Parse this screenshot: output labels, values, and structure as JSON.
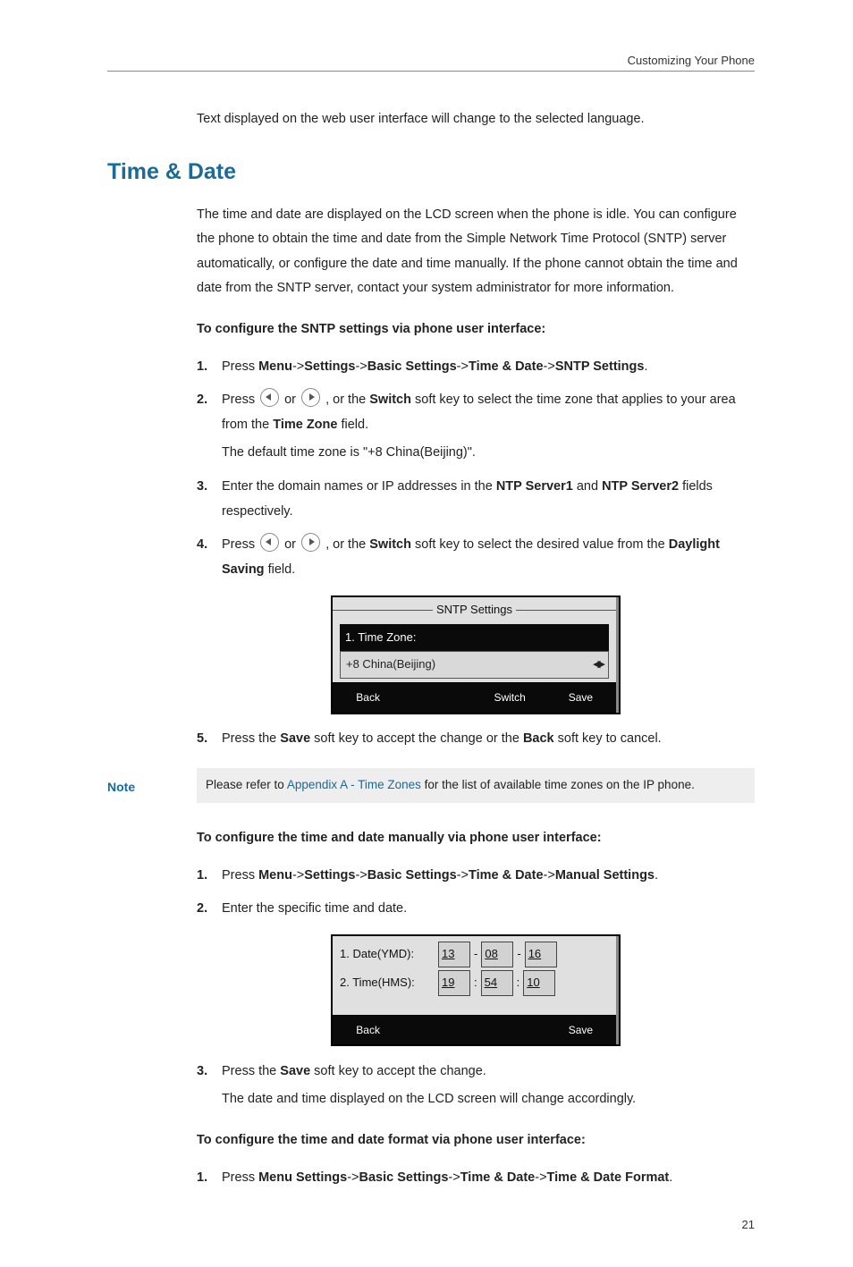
{
  "header": {
    "section": "Customizing Your Phone"
  },
  "intro_continued": "Text displayed on the web user interface will change to the selected language.",
  "section_title": "Time & Date",
  "overview": "The time and date are displayed on the LCD screen when the phone is idle. You can configure the phone to obtain the time and date from the Simple Network Time Protocol (SNTP) server automatically, or configure the date and time manually. If the phone cannot obtain the time and date from the SNTP server, contact your system administrator for more information.",
  "sntp": {
    "heading": "To configure the SNTP settings via phone user interface:",
    "steps": [
      {
        "num": "1.",
        "pre": "Press ",
        "path": [
          "Menu",
          "Settings",
          "Basic Settings",
          "Time & Date",
          "SNTP Settings"
        ],
        "post": "."
      },
      {
        "num": "2.",
        "pre": "Press ",
        "arrows": true,
        "mid1": " , or the ",
        "switch": "Switch",
        "mid2": " soft key to select the time zone that applies to your area from the ",
        "field": "Time Zone",
        "post": " field.",
        "sub": "The default time zone is \"+8 China(Beijing)\"."
      },
      {
        "num": "3.",
        "pre": "Enter the domain names or IP addresses in the ",
        "f1": "NTP Server1",
        "mid": " and ",
        "f2": "NTP Server2",
        "post": " fields respectively."
      },
      {
        "num": "4.",
        "pre": "Press ",
        "arrows": true,
        "mid1": " , or the ",
        "switch": "Switch",
        "mid2": " soft key to select the desired value from the ",
        "field": "Daylight Saving",
        "post": " field."
      },
      {
        "num": "5.",
        "pre": "Press the ",
        "save": "Save",
        "mid": " soft key to accept the change or the ",
        "back": "Back",
        "post": " soft key to cancel."
      }
    ]
  },
  "lcd_sntp": {
    "title": "SNTP Settings",
    "field_label": "1. Time Zone:",
    "field_value": "+8 China(Beijing)",
    "softkeys": [
      "Back",
      "",
      "Switch",
      "Save"
    ]
  },
  "note": {
    "label": "Note",
    "pre": "Please refer to ",
    "link": "Appendix A - Time Zones",
    "post": " for the list of available time zones on the IP phone."
  },
  "manual": {
    "heading": "To configure the time and date manually via phone user interface:",
    "steps": [
      {
        "num": "1.",
        "pre": "Press ",
        "path": [
          "Menu",
          "Settings",
          "Basic Settings",
          "Time & Date",
          "Manual Settings"
        ],
        "post": "."
      },
      {
        "num": "2.",
        "text": "Enter the specific time and date."
      },
      {
        "num": "3.",
        "pre": "Press the ",
        "save": "Save",
        "post": " soft key to accept the change.",
        "sub": "The date and time displayed on the LCD screen will change accordingly."
      }
    ]
  },
  "lcd_manual": {
    "rows": [
      {
        "label": "1. Date(YMD):",
        "v1": "13",
        "s1": "-",
        "v2": "08",
        "s2": "-",
        "v3": "16"
      },
      {
        "label": "2. Time(HMS):",
        "v1": "19",
        "s1": ":",
        "v2": "54",
        "s2": ":",
        "v3": "10"
      }
    ],
    "softkeys": [
      "Back",
      "",
      "",
      "Save"
    ]
  },
  "format": {
    "heading": "To configure the time and date format via phone user interface:",
    "step": {
      "num": "1.",
      "pre": "Press ",
      "path": [
        "Menu Settings",
        "Basic Settings",
        "Time & Date",
        "Time & Date Format"
      ],
      "post": "."
    }
  },
  "page_number": "21",
  "ui": {
    "or": " or ",
    "arrow": "->"
  },
  "chart_data": {
    "type": "table",
    "title": "Phone LCD screenshots embedded in manual page",
    "tables": [
      {
        "name": "SNTP Settings screen",
        "fields": [
          {
            "label": "Time Zone",
            "value": "+8 China(Beijing)"
          }
        ],
        "softkeys": [
          "Back",
          "",
          "Switch",
          "Save"
        ]
      },
      {
        "name": "Manual Settings screen",
        "fields": [
          {
            "label": "Date(YMD)",
            "value": [
              "13",
              "08",
              "16"
            ]
          },
          {
            "label": "Time(HMS)",
            "value": [
              "19",
              "54",
              "10"
            ]
          }
        ],
        "softkeys": [
          "Back",
          "",
          "",
          "Save"
        ]
      }
    ]
  }
}
